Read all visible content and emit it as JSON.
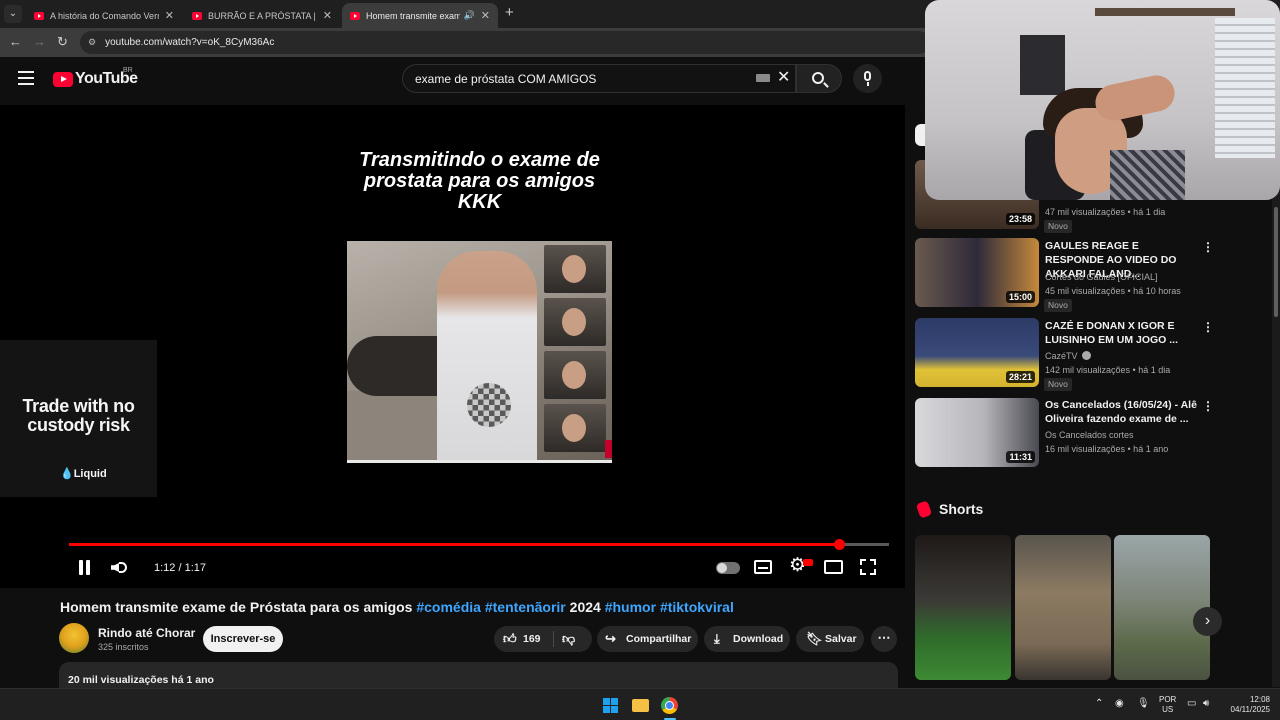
{
  "browser": {
    "tabs": [
      {
        "title": "A história do Comando Vermelho",
        "active": false
      },
      {
        "title": "BURRÃO E A PRÓSTATA | EMBRA",
        "active": false
      },
      {
        "title": "Homem transmite exame de",
        "active": true
      }
    ],
    "url": "youtube.com/watch?v=oK_8CyM36Ac"
  },
  "youtube": {
    "logo_text": "YouTube",
    "country_code": "BR",
    "search_query": "exame de próstata COM AMIGOS"
  },
  "player": {
    "overlay_caption": "Transmitindo o exame de prostata para os amigos KKK",
    "time_display": "1:12 / 1:17",
    "progress_fraction": 0.939,
    "accent_color": "#ff0000"
  },
  "ad": {
    "headline": "Trade with no custody risk",
    "brand": "Liquid"
  },
  "video": {
    "title_plain": "Homem transmite exame de Próstata para os amigos",
    "hashtag_1": "#comédia",
    "hashtag_2": "#tentenãorir",
    "year": "2024",
    "hashtag_3": "#humor",
    "hashtag_4": "#tiktokviral",
    "channel_name": "Rindo até Chorar",
    "subscribers": "325 inscritos",
    "subscribe_label": "Inscrever-se",
    "like_count": "169",
    "share_label": "Compartilhar",
    "download_label": "Download",
    "save_label": "Salvar",
    "description_meta": "20 mil visualizações  há 1 ano"
  },
  "sidebar": {
    "top_item": {
      "duration": "23:58",
      "stats": "47 mil visualizações • há 1 dia",
      "badge": "Novo"
    },
    "items": [
      {
        "title": "GAULES REAGE E RESPONDE AO VIDEO DO AKKARI FALAND...",
        "channel": "Cortes do Gaules [OFICIAL]",
        "stats": "45 mil visualizações • há 10 horas",
        "badge": "Novo",
        "duration": "15:00"
      },
      {
        "title": "CAZÉ E DONAN X IGOR E LUISINHO EM UM JOGO ...",
        "channel": "CazéTV",
        "stats": "142 mil visualizações • há 1 dia",
        "badge": "Novo",
        "duration": "28:21"
      },
      {
        "title": "Os Cancelados (16/05/24) - Alê Oliveira fazendo exame  de ...",
        "channel": "Os Cancelados cortes",
        "stats": "16 mil visualizações • há 1 ano",
        "badge": "",
        "duration": "11:31"
      }
    ],
    "shorts_heading": "Shorts"
  },
  "taskbar": {
    "lang_top": "POR",
    "lang_bottom": "US",
    "time": "12:08",
    "date": "04/11/2025"
  }
}
